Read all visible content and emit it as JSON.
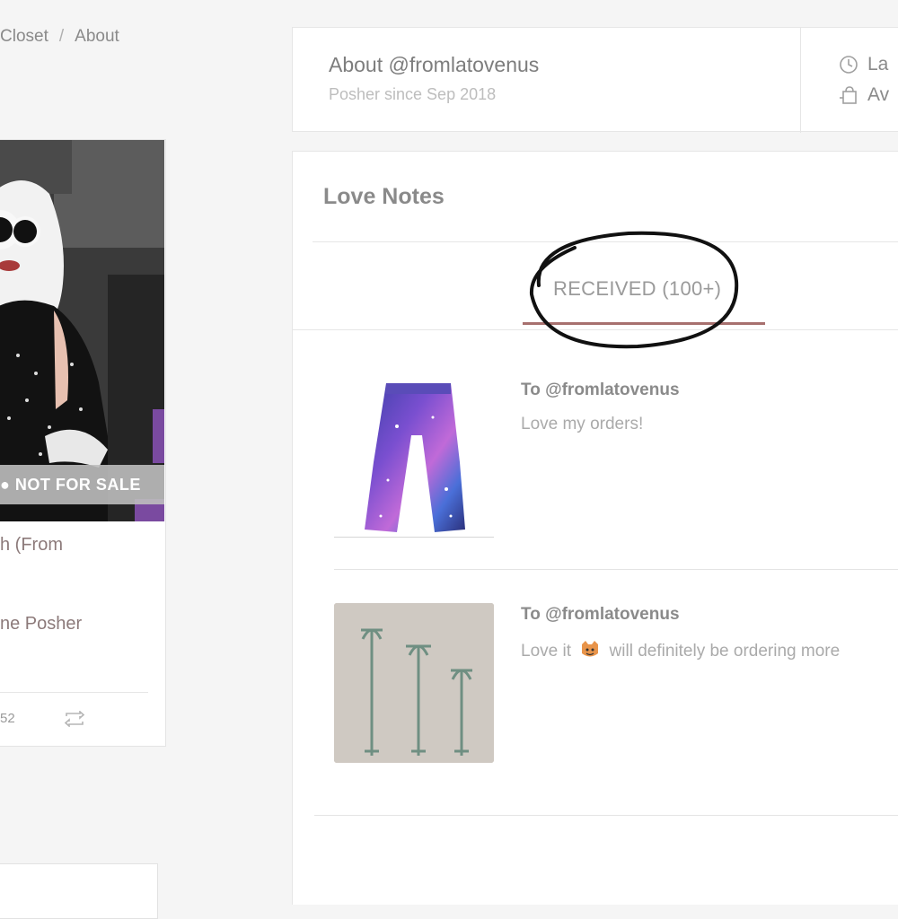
{
  "breadcrumb": {
    "item1": "Closet",
    "separator": "/",
    "item2": "About"
  },
  "listing": {
    "badge": "NOT FOR SALE",
    "title_fragment": "h (From",
    "subtitle_fragment": "ne Posher",
    "likes_count": "52"
  },
  "about": {
    "title": "About @fromlatovenus",
    "subtitle": "Posher since Sep 2018",
    "stat1_fragment": "La",
    "stat2_fragment": "Av"
  },
  "love_notes": {
    "title": "Love Notes",
    "tab_label": "RECEIVED (100+)",
    "notes": [
      {
        "to": "To @fromlatovenus",
        "message": "Love my orders!"
      },
      {
        "to": "To @fromlatovenus",
        "message_before_emoji": "Love it",
        "emoji": "cat-face-emoji",
        "message_after_emoji": "will definitely be ordering more"
      }
    ]
  },
  "colors": {
    "tab_underline": "#a7706e",
    "annotation_ring": "#111111",
    "listing_text": "#8c7a7a"
  }
}
